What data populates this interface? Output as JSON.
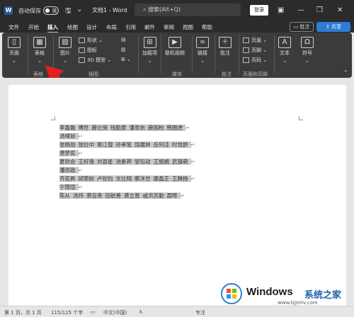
{
  "titlebar": {
    "autosave_label": "自动保存",
    "autosave_state": "关",
    "doc_title": "文档1 - Word",
    "search_placeholder": "搜索(Alt+Q)",
    "login_label": "登录",
    "minimize": "—",
    "restore": "❐",
    "close": "✕"
  },
  "menubar": {
    "tabs": [
      "文件",
      "开始",
      "插入",
      "绘图",
      "设计",
      "布局",
      "引用",
      "邮件",
      "审阅",
      "视图",
      "帮助"
    ],
    "active_tab": "插入",
    "comment_label": "批注",
    "share_label": "共享"
  },
  "ribbon": {
    "pages_label": "页面",
    "table_label": "表格",
    "table_group": "表格",
    "picture_label": "图片",
    "shapes_label": "形状",
    "icons_label": "图标",
    "model3d_label": "3D 模型",
    "illustrations_group": "插图",
    "addins_label": "加载项",
    "online_video_label": "联机视频",
    "media_group": "媒体",
    "link_label": "链接",
    "comment_label": "批注",
    "comment_group": "批注",
    "header_label": "页眉",
    "footer_label": "页脚",
    "pagenum_label": "页码",
    "headerfooter_group": "页眉和页脚",
    "text_label": "文本",
    "symbol_label": "符号"
  },
  "document": {
    "lines": [
      [
        "李鑫磊",
        "傅世",
        "薛壮保",
        "钱勤意",
        "潘思依",
        "薛国柏",
        "韩图虎"
      ],
      [
        "汤啤祯"
      ],
      [
        "张杨勋",
        "张灶中",
        "易江僧",
        "孙孝笔",
        "饶展林",
        "岳列洼",
        "时觉舒"
      ],
      [
        "唐梦奕"
      ],
      [
        "夏劲会",
        "王好逸",
        "刘县星",
        "池素莽",
        "邹包动",
        "王施娟",
        "武镇萌"
      ],
      [
        "潘供政"
      ],
      [
        "齐奕昇",
        "邱荣树",
        "卢钦钧",
        "文壮翔",
        "蔡沐甘",
        "康鑫正",
        "王腾扬"
      ],
      [
        "宁雨煊"
      ],
      [
        "陈从",
        "汤炜",
        "萧百贵",
        "田航善",
        "龚立恩",
        "戚洪苏勤",
        "聂晖"
      ]
    ]
  },
  "statusbar": {
    "page_info": "第 1 页，共 1 页",
    "word_count": "115/115 个字",
    "language": "中文(中国)",
    "focus_label": "专注"
  },
  "watermark": {
    "brand": "Windows",
    "brand_cn": "系统之家",
    "url": "www.bjjmlv.com"
  }
}
